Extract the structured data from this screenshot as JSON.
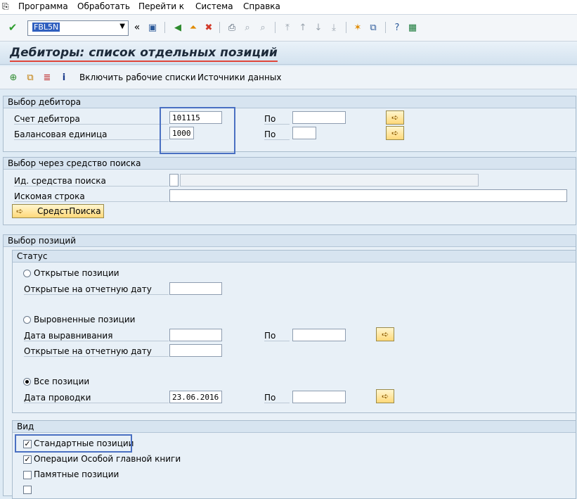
{
  "menubar": {
    "items": [
      "Программа",
      "Обработать",
      "Перейти к",
      "Система",
      "Справка"
    ]
  },
  "toolbar": {
    "command_field_value": "FBL5N"
  },
  "title": "Дебиторы: список отдельных позиций",
  "app_toolbar": {
    "buttons": [
      "Включить рабочие списки",
      "Источники данных"
    ]
  },
  "customer_selection": {
    "header": "Выбор дебитора",
    "to_label": "По",
    "rows": [
      {
        "label": "Счет дебитора",
        "value": "101115",
        "to_value": ""
      },
      {
        "label": "Балансовая единица",
        "value": "1000",
        "to_value": ""
      }
    ]
  },
  "search_help": {
    "header": "Выбор через средство поиска",
    "id_label": "Ид. средства поиска",
    "id_value": "",
    "search_string_label": "Искомая строка",
    "search_string_value": "",
    "button_label": "СредстПоиска"
  },
  "item_selection": {
    "header": "Выбор позиций",
    "status": {
      "header": "Статус",
      "open_items": {
        "label": "Открытые позиции",
        "selected": false
      },
      "open_at_key_date_label": "Открытые на отчетную дату",
      "cleared_items": {
        "label": "Выровненные позиции",
        "selected": false
      },
      "clearing_date_label": "Дата выравнивания",
      "open_at_key_date_label_2": "Открытые на отчетную дату",
      "all_items": {
        "label": "Все позиции",
        "selected": true
      },
      "posting_date_label": "Дата проводки",
      "posting_date_value": "23.06.2016",
      "to_label": "По"
    },
    "type": {
      "header": "Вид",
      "options": [
        {
          "label": "Стандартные позиции",
          "checked": true
        },
        {
          "label": "Операции Особой главной книги",
          "checked": true
        },
        {
          "label": "Памятные позиции",
          "checked": false
        }
      ]
    }
  }
}
